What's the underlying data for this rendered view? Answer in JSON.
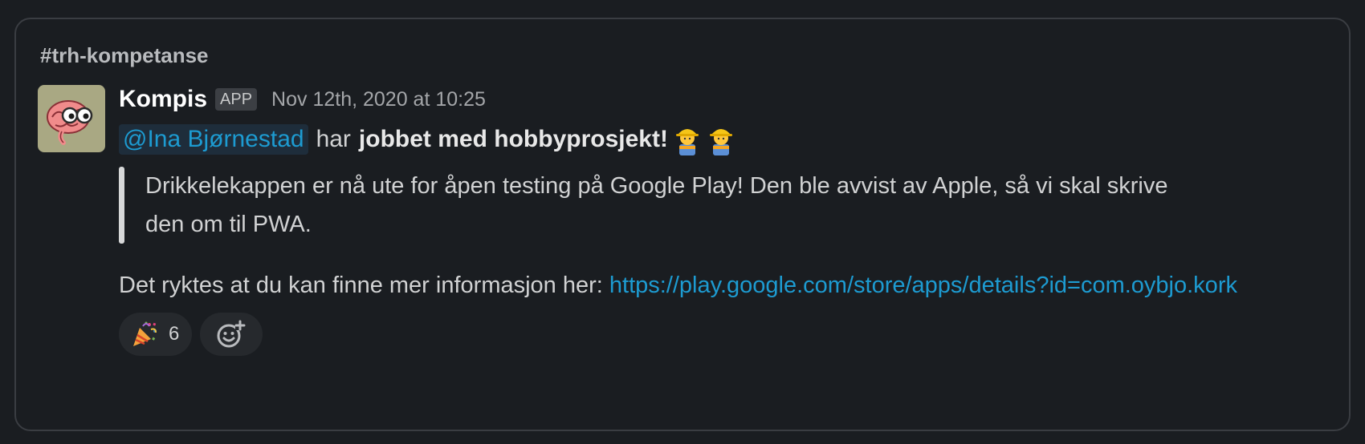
{
  "channel": "#trh-kompetanse",
  "message": {
    "sender": "Kompis",
    "badge": "APP",
    "timestamp": "Nov 12th, 2020 at 10:25",
    "mention": "@Ina Bjørnestad",
    "verb": "har",
    "activity": "jobbet med hobbyprosjekt!",
    "emoji": [
      "woman-construction-worker-icon",
      "man-construction-worker-icon"
    ],
    "quote": "Drikkelekappen er nå ute for åpen testing på Google Play! Den ble avvist av Apple, så vi skal skrive den om til PWA.",
    "info_prefix": "Det ryktes at du kan finne mer informasjon her:",
    "link": "https://play.google.com/store/apps/details?id=com.oybjo.kork"
  },
  "reactions": [
    {
      "icon": "party-popper-icon",
      "count": "6"
    }
  ],
  "colors": {
    "background": "#1a1d21",
    "link": "#1d9bd1",
    "avatar_bg": "#a9a883"
  }
}
